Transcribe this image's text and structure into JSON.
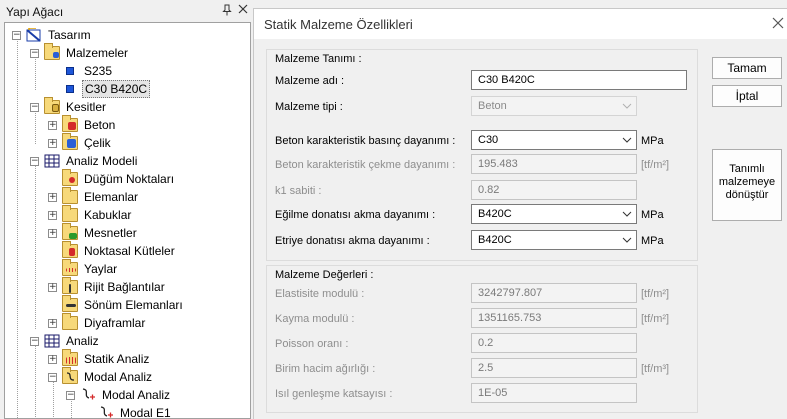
{
  "tree": {
    "title": "Yapı Ağacı",
    "pin_glyph": "📌",
    "close_glyph": "×",
    "items": [
      {
        "label": "Tasarım"
      },
      {
        "label": "Malzemeler"
      },
      {
        "label": "S235"
      },
      {
        "label": "C30 B420C"
      },
      {
        "label": "Kesitler"
      },
      {
        "label": "Beton"
      },
      {
        "label": "Çelik"
      },
      {
        "label": "Analiz Modeli"
      },
      {
        "label": "Düğüm Noktaları"
      },
      {
        "label": "Elemanlar"
      },
      {
        "label": "Kabuklar"
      },
      {
        "label": "Mesnetler"
      },
      {
        "label": "Noktasal Kütleler"
      },
      {
        "label": "Yaylar"
      },
      {
        "label": "Rijit Bağlantılar"
      },
      {
        "label": "Sönüm Elemanları"
      },
      {
        "label": "Diyaframlar"
      },
      {
        "label": "Analiz"
      },
      {
        "label": "Statik Analiz"
      },
      {
        "label": "Modal Analiz"
      },
      {
        "label": "Modal Analiz"
      },
      {
        "label": "Modal E1"
      }
    ]
  },
  "dialog": {
    "title": "Statik Malzeme Özellikleri",
    "close_glyph": "✕",
    "definition": {
      "group_title": "Malzeme Tanımı :",
      "name_label": "Malzeme adı :",
      "name_value": "C30 B420C",
      "type_label": "Malzeme tipi :",
      "type_value": "Beton",
      "fck_label": "Beton karakteristik basınç dayanımı :",
      "fck_value": "C30",
      "fck_unit": "MPa",
      "fctk_label": "Beton karakteristik çekme dayanımı :",
      "fctk_value": "195.483",
      "fctk_unit": "[tf/m²]",
      "k1_label": "k1 sabiti :",
      "k1_value": "0.82",
      "fyk_label": "Eğilme donatısı akma dayanımı :",
      "fyk_value": "B420C",
      "fyk_unit": "MPa",
      "fywk_label": "Etriye donatısı akma dayanımı :",
      "fywk_value": "B420C",
      "fywk_unit": "MPa"
    },
    "values": {
      "group_title": "Malzeme Değerleri :",
      "e_label": "Elastisite modulü :",
      "e_value": "3242797.807",
      "e_unit": "[tf/m²]",
      "g_label": "Kayma modulü :",
      "g_value": "1351165.753",
      "g_unit": "[tf/m²]",
      "nu_label": "Poisson oranı :",
      "nu_value": "0.2",
      "gamma_label": "Birim hacim ağırlığı :",
      "gamma_value": "2.5",
      "gamma_unit": "[tf/m³]",
      "alpha_label": "Isıl genleşme katsayısı :",
      "alpha_value": "1E-05"
    },
    "buttons": {
      "ok": "Tamam",
      "cancel": "İptal",
      "convert_line1": "Tanımlı",
      "convert_line2": "malzemeye",
      "convert_line3": "dönüştür"
    }
  }
}
